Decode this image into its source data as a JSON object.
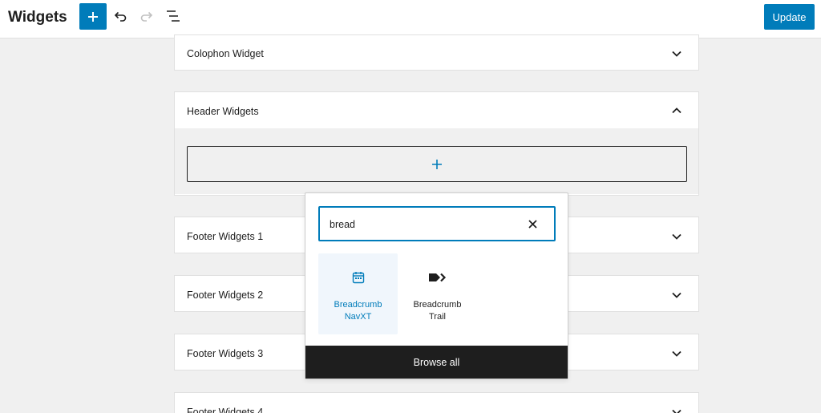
{
  "header": {
    "title": "Widgets",
    "update_label": "Update"
  },
  "icons": {
    "add": "plus-icon",
    "undo": "undo-icon",
    "redo": "redo-icon",
    "list_view": "list-view-icon"
  },
  "colors": {
    "accent": "#007cba",
    "dark": "#1e1e1e",
    "background": "#f0f0f0"
  },
  "widget_areas": [
    {
      "label": "Colophon Widget",
      "expanded": false
    },
    {
      "label": "Header Widgets",
      "expanded": true
    },
    {
      "label": "Footer Widgets 1",
      "expanded": false
    },
    {
      "label": "Footer Widgets 2",
      "expanded": false
    },
    {
      "label": "Footer Widgets 3",
      "expanded": false
    },
    {
      "label": "Footer Widgets 4",
      "expanded": false
    }
  ],
  "inserter": {
    "search_value": "bread",
    "results": [
      {
        "line1": "Breadcrumb",
        "line2": "NavXT",
        "icon": "calendar-icon",
        "highlighted": true
      },
      {
        "line1": "Breadcrumb",
        "line2": "Trail",
        "icon": "breadcrumb-arrow-icon",
        "highlighted": false
      }
    ],
    "browse_all_label": "Browse all"
  }
}
